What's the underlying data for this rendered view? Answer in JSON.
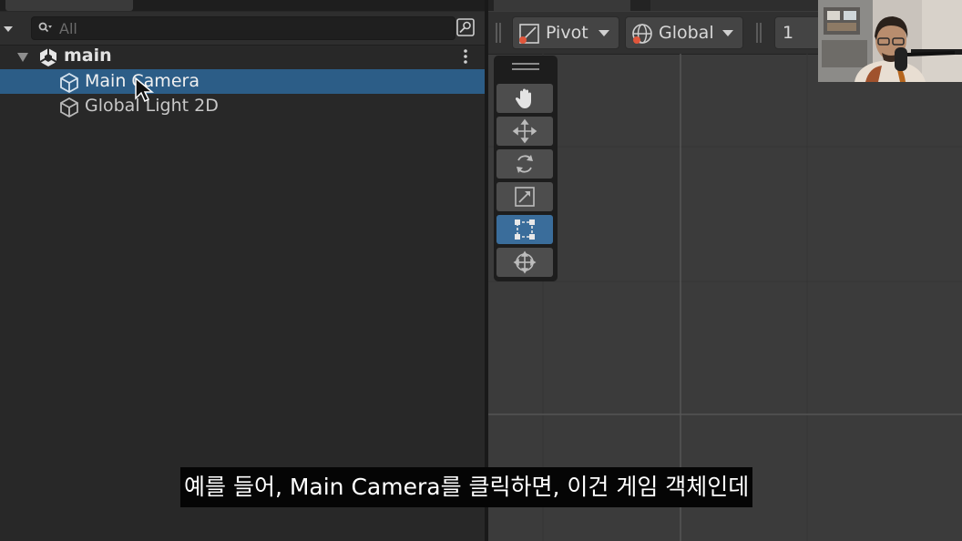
{
  "hierarchy": {
    "search": {
      "placeholder": "All",
      "value": ""
    },
    "scene_name": "main",
    "items": [
      {
        "label": "Main Camera",
        "selected": true
      },
      {
        "label": "Global Light 2D",
        "selected": false
      }
    ]
  },
  "scene_view": {
    "pivot_label": "Pivot",
    "global_label": "Global",
    "grid_snap_value": "1",
    "tools": [
      "hand-tool",
      "move-tool",
      "rotate-tool",
      "scale-tool",
      "rect-tool",
      "transform-tool"
    ],
    "active_tool": "rect-tool"
  },
  "subtitle": {
    "text": "예를 들어,  Main Camera를 클릭하면, 이건 게임 객체인데"
  },
  "colors": {
    "selection": "#2c5d87",
    "active_tool": "#3a6d9b",
    "panel_bg": "#282828",
    "scene_bg": "#3b3b3b"
  }
}
